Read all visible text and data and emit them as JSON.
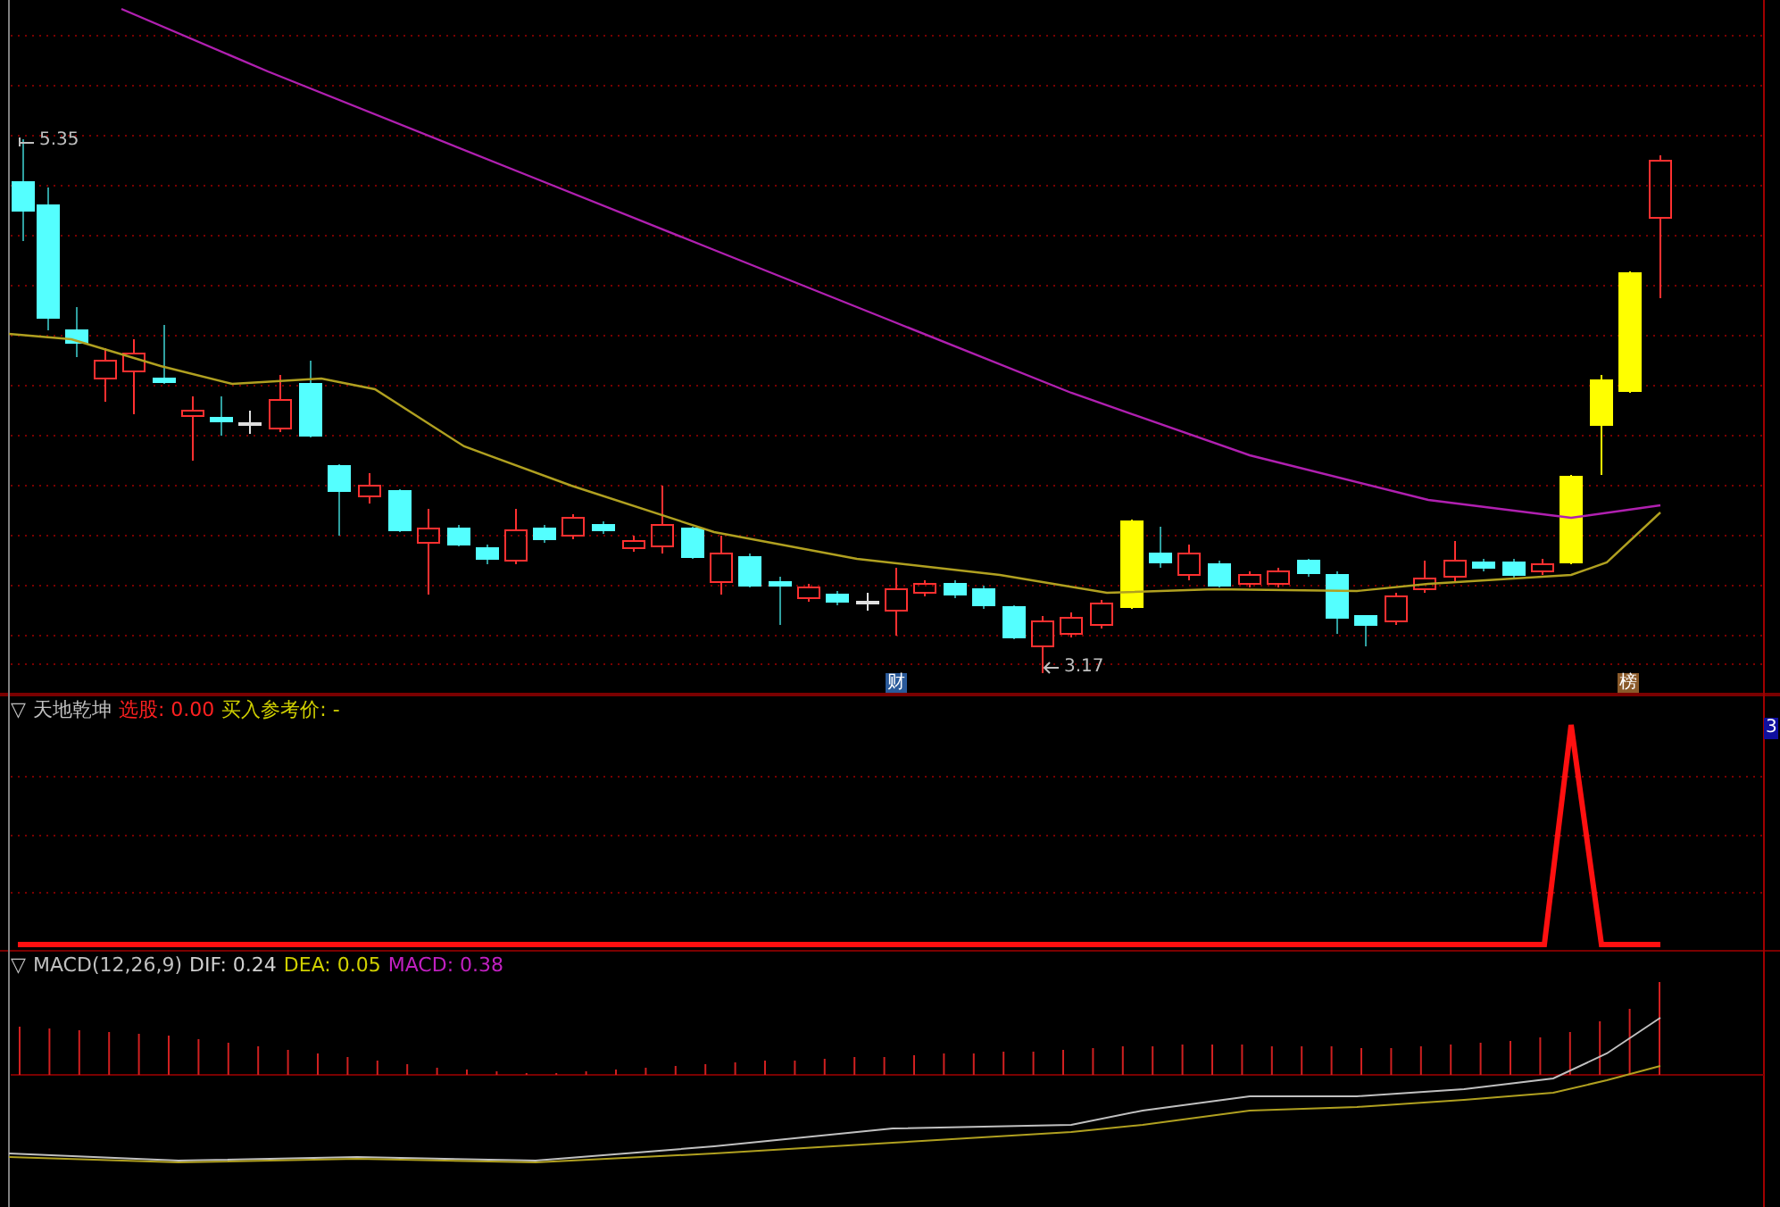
{
  "main_panel": {
    "high_label": "5.35",
    "low_label": "3.17",
    "markers": [
      {
        "text": "财",
        "color": "#2a5a9a"
      },
      {
        "text": "榜",
        "color": "#8a5a2a"
      }
    ]
  },
  "indicator_panel": {
    "collapse_glyph": "▽",
    "title": "天地乾坤",
    "fields": [
      {
        "text": "选股: 0.00",
        "color": "#ff2020"
      },
      {
        "text": "买入参考价: -",
        "color": "#d0d000"
      }
    ],
    "axis_label": "3"
  },
  "macd_panel": {
    "collapse_glyph": "▽",
    "title": "MACD(12,26,9)",
    "fields": [
      {
        "text": "DIF: 0.24",
        "color": "#d0d0d0"
      },
      {
        "text": "DEA: 0.05",
        "color": "#d0d000"
      },
      {
        "text": "MACD: 0.38",
        "color": "#c020c0"
      }
    ]
  }
}
